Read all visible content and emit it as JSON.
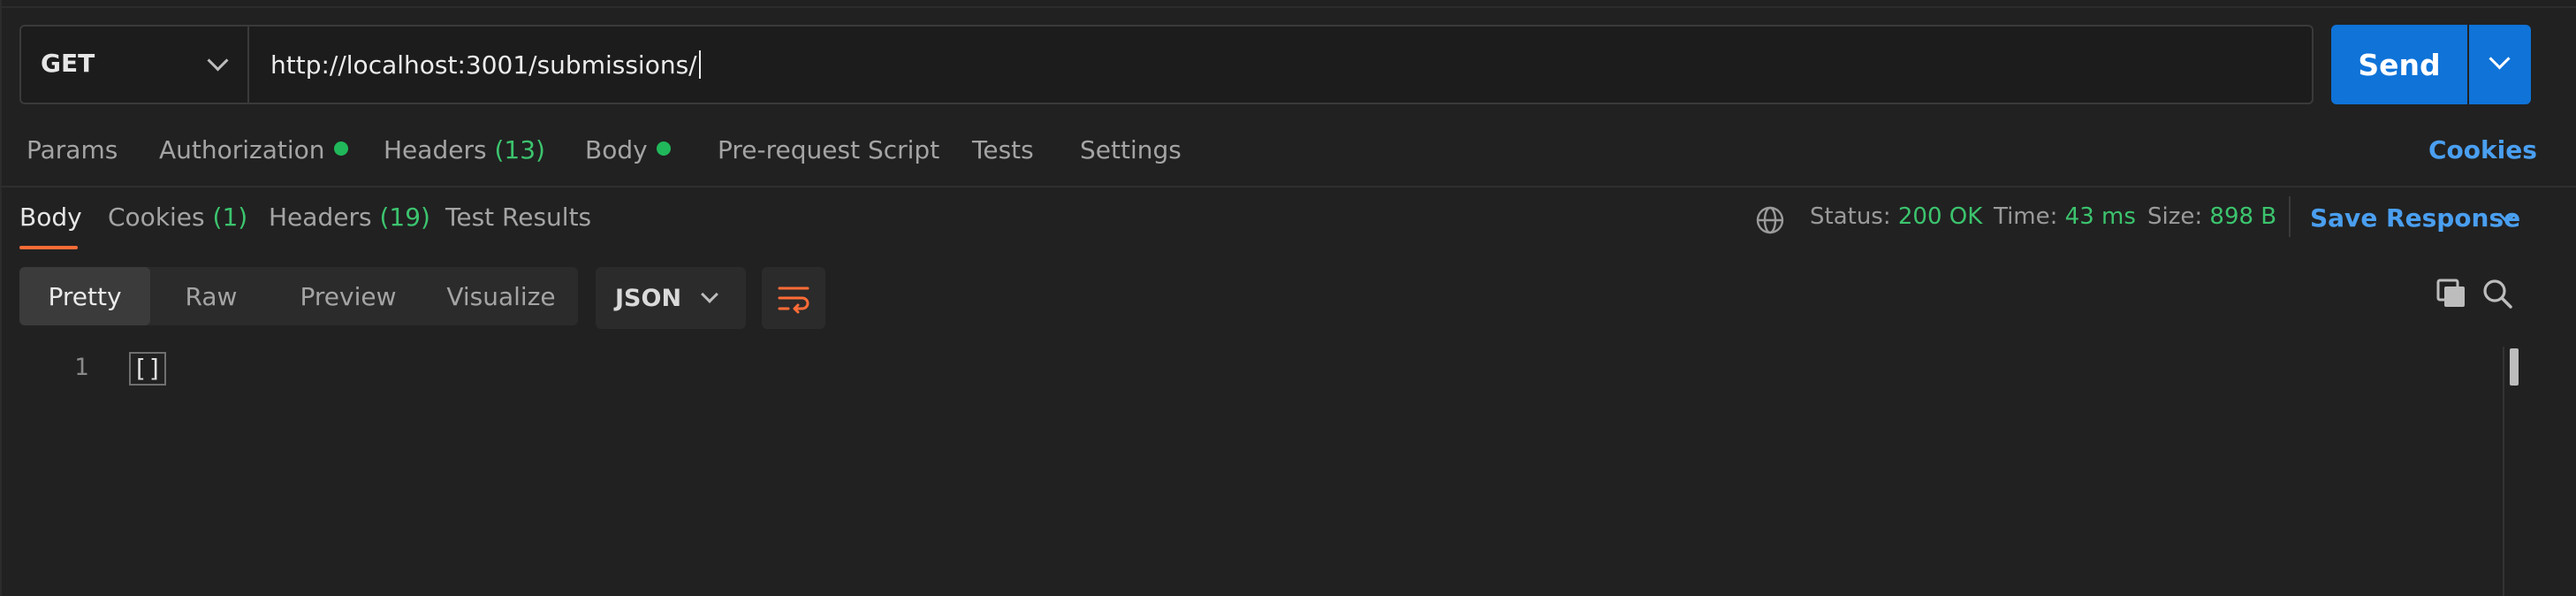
{
  "request": {
    "method": "GET",
    "url": "http://localhost:3001/submissions/",
    "send_label": "Send"
  },
  "request_tabs": {
    "params": "Params",
    "authorization": "Authorization",
    "headers": "Headers",
    "headers_count": "(13)",
    "body": "Body",
    "pre_request": "Pre-request Script",
    "tests": "Tests",
    "settings": "Settings",
    "cookies": "Cookies"
  },
  "response_tabs": {
    "body": "Body",
    "cookies": "Cookies",
    "cookies_count": "(1)",
    "headers": "Headers",
    "headers_count": "(19)",
    "test_results": "Test Results"
  },
  "response_meta": {
    "status_label": "Status:",
    "status_value": "200 OK",
    "time_label": "Time:",
    "time_value": "43 ms",
    "size_label": "Size:",
    "size_value": "898 B",
    "save_response": "Save Response"
  },
  "view_modes": [
    "Pretty",
    "Raw",
    "Preview",
    "Visualize"
  ],
  "active_view": "Pretty",
  "format": "JSON",
  "editor": {
    "line_numbers": [
      "1"
    ],
    "lines": [
      "[]"
    ]
  },
  "colors": {
    "accent": "#ff6c37",
    "send_button": "#0f73d8",
    "link": "#4a9ff0",
    "success": "#3cc46e"
  },
  "icons": [
    "chevron-down-icon",
    "globe-icon",
    "wrap-lines-icon",
    "copy-icon",
    "search-icon"
  ]
}
